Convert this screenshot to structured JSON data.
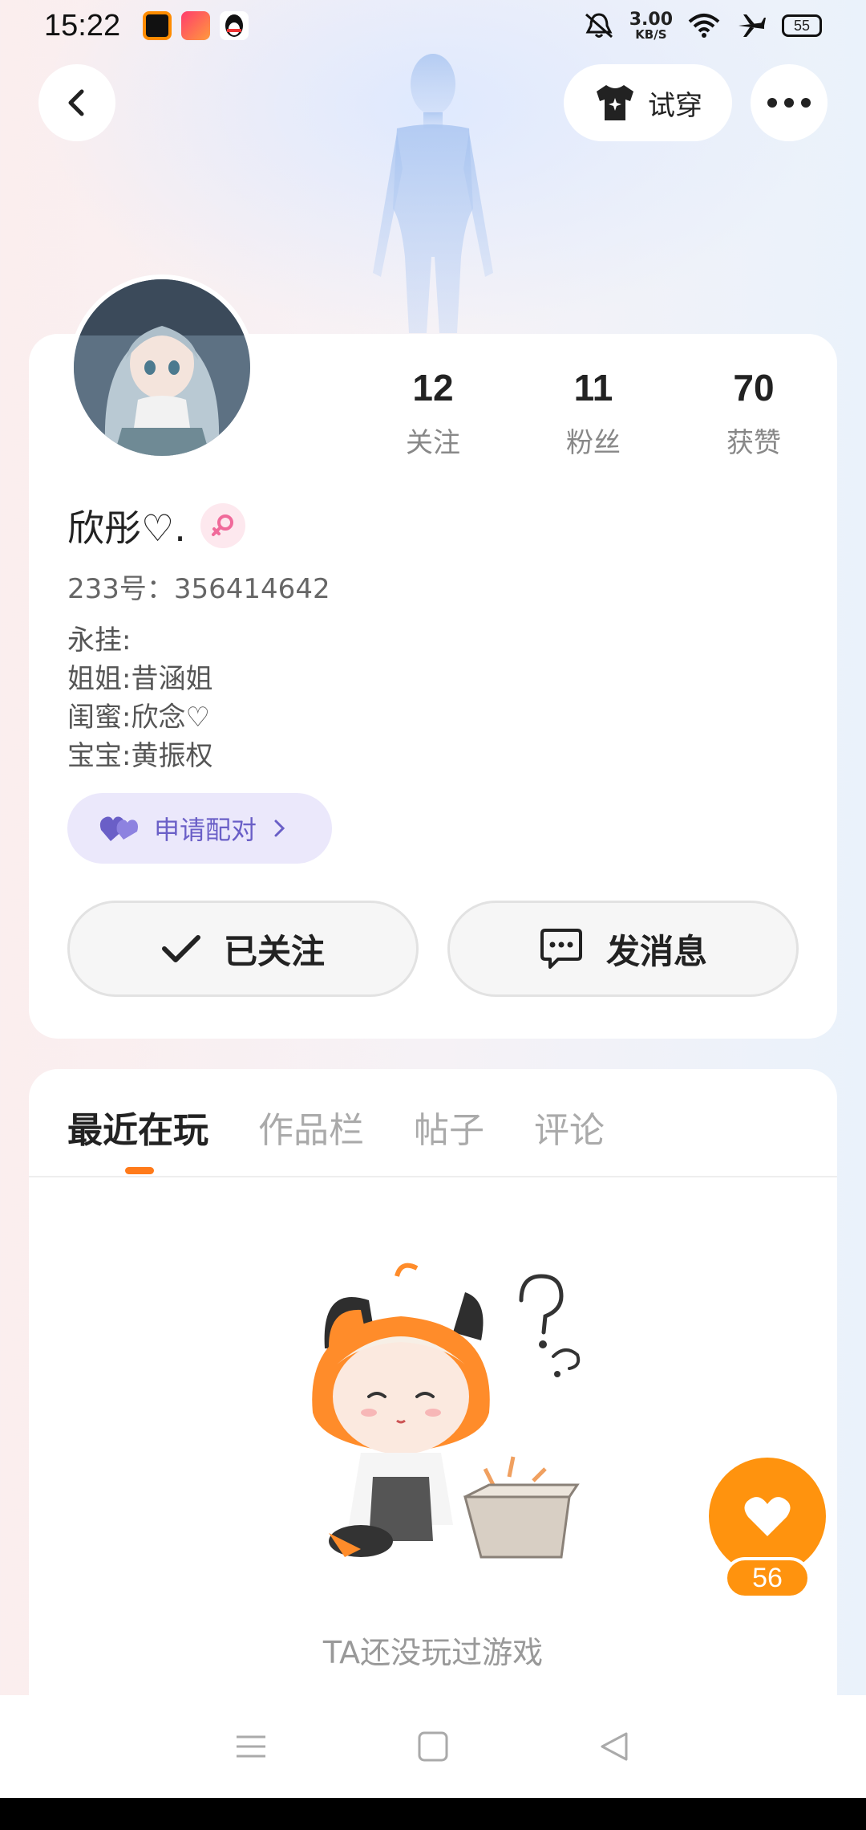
{
  "status_bar": {
    "time": "15:22",
    "net_speed_value": "3.00",
    "net_speed_unit": "KB/S",
    "battery": "55",
    "icons": [
      "mute-bell-icon",
      "wifi-icon",
      "airplane-icon"
    ]
  },
  "header": {
    "tryon_label": "试穿"
  },
  "profile": {
    "stats": [
      {
        "num": "12",
        "label": "关注"
      },
      {
        "num": "11",
        "label": "粉丝"
      },
      {
        "num": "70",
        "label": "获赞"
      }
    ],
    "name": "欣彤♡.",
    "uid": "233号：356414642",
    "bio": [
      "永挂:",
      "姐姐:昔涵姐",
      "闺蜜:欣念♡",
      "宝宝:黄振权"
    ],
    "pair_label": "申请配对",
    "follow_label": "已关注",
    "message_label": "发消息"
  },
  "tabs": {
    "items": [
      "最近在玩",
      "作品栏",
      "帖子",
      "评论"
    ],
    "active": 0
  },
  "empty_state": {
    "text": "TA还没玩过游戏"
  },
  "like": {
    "count": "56"
  },
  "colors": {
    "accent_orange": "#ff930e",
    "tab_indicator": "#ff7a1a",
    "pair_purple": "#6a5fc7"
  }
}
